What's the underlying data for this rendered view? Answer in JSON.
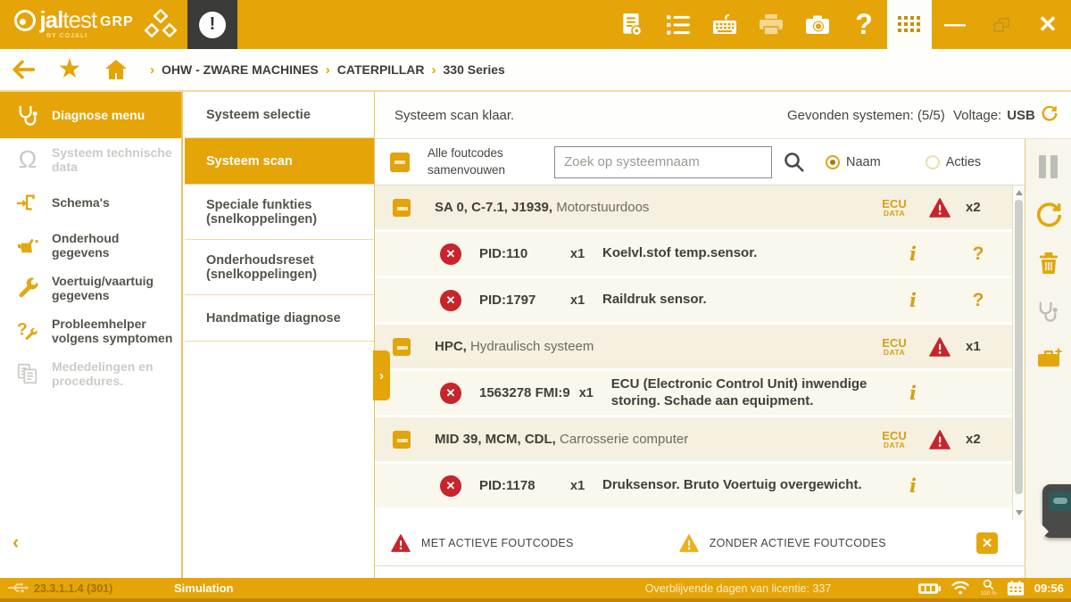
{
  "app": {
    "logo_bold": "jal",
    "logo_light": "test",
    "logo_sub": "BY COJALI",
    "grp": "GRP"
  },
  "breadcrumb": {
    "items": [
      "OHW - ZWARE MACHINES",
      "CATERPILLAR",
      "330 Series"
    ]
  },
  "sidebar": {
    "items": [
      {
        "label": "Diagnose menu",
        "state": "active"
      },
      {
        "label": "Systeem technische data",
        "state": "disabled"
      },
      {
        "label": "Schema's",
        "state": "normal"
      },
      {
        "label": "Onderhoud gegevens",
        "state": "normal"
      },
      {
        "label": "Voertuig/vaartuig gegevens",
        "state": "normal"
      },
      {
        "label": "Probleemhelper volgens symptomen",
        "state": "normal"
      },
      {
        "label": "Mededelingen en procedures.",
        "state": "disabled"
      }
    ]
  },
  "submenu": {
    "items": [
      {
        "label": "Systeem selectie",
        "state": "normal"
      },
      {
        "label": "Systeem scan",
        "state": "active"
      },
      {
        "label": "Speciale funkties (snelkoppelingen)",
        "state": "normal"
      },
      {
        "label": "Onderhoudsreset (snelkoppelingen)",
        "state": "normal"
      },
      {
        "label": "Handmatige diagnose",
        "state": "normal"
      }
    ]
  },
  "scan": {
    "status_text": "Systeem scan klaar.",
    "found_label": "Gevonden systemen: (5/5)",
    "voltage_label": "Voltage:",
    "voltage_value": "USB",
    "collapse_label": "Alle foutcodes samenvouwen",
    "search_placeholder": "Zoek op systeemnaam",
    "radio_name": "Naam",
    "radio_actions": "Acties",
    "systems": [
      {
        "code": "SA 0, C-7.1, J1939,",
        "name": "Motorstuurdoos",
        "badge_line1": "ECU",
        "badge_line2": "DATA",
        "count": "x2",
        "faults": [
          {
            "code": "PID:110",
            "times": "x1",
            "desc": "Koelvl.stof temp.sensor.",
            "info": true,
            "help": true
          },
          {
            "code": "PID:1797",
            "times": "x1",
            "desc": "Raildruk sensor.",
            "info": true,
            "help": true
          }
        ]
      },
      {
        "code": "HPC,",
        "name": "Hydraulisch systeem",
        "badge_line1": "ECU",
        "badge_line2": "DATA",
        "count": "x1",
        "faults": [
          {
            "code": "1563278 FMI:9",
            "times": "x1",
            "desc": "ECU (Electronic Control Unit) inwendige storing. Schade aan equipment.",
            "info": true,
            "help": false
          }
        ]
      },
      {
        "code": "MID 39, MCM, CDL,",
        "name": "Carrosserie computer",
        "badge_line1": "ECU",
        "badge_line2": "DATA",
        "count": "x2",
        "faults": [
          {
            "code": "PID:1178",
            "times": "x1",
            "desc": "Druksensor. Bruto Voertuig overgewicht.",
            "info": true,
            "help": false
          }
        ]
      }
    ],
    "legend": [
      {
        "label": "MET ACTIEVE FOUTCODES",
        "type": "active"
      },
      {
        "label": "ZONDER ACTIEVE FOUTCODES",
        "type": "inactive"
      }
    ]
  },
  "statusbar": {
    "version": "23.3.1.1.4 (301)",
    "mode": "Simulation",
    "license": "Overblijvende dagen van licentie: 337",
    "zoom": "100 %",
    "time": "09:56"
  },
  "colors": {
    "primary": "#E5A408",
    "dark_tab": "#3B3B3A",
    "alert_red": "#C8242C",
    "warn_amber": "#EFAF1C",
    "icon_yellow": "#E2A70D",
    "row_cream": "#F5F0DF"
  }
}
